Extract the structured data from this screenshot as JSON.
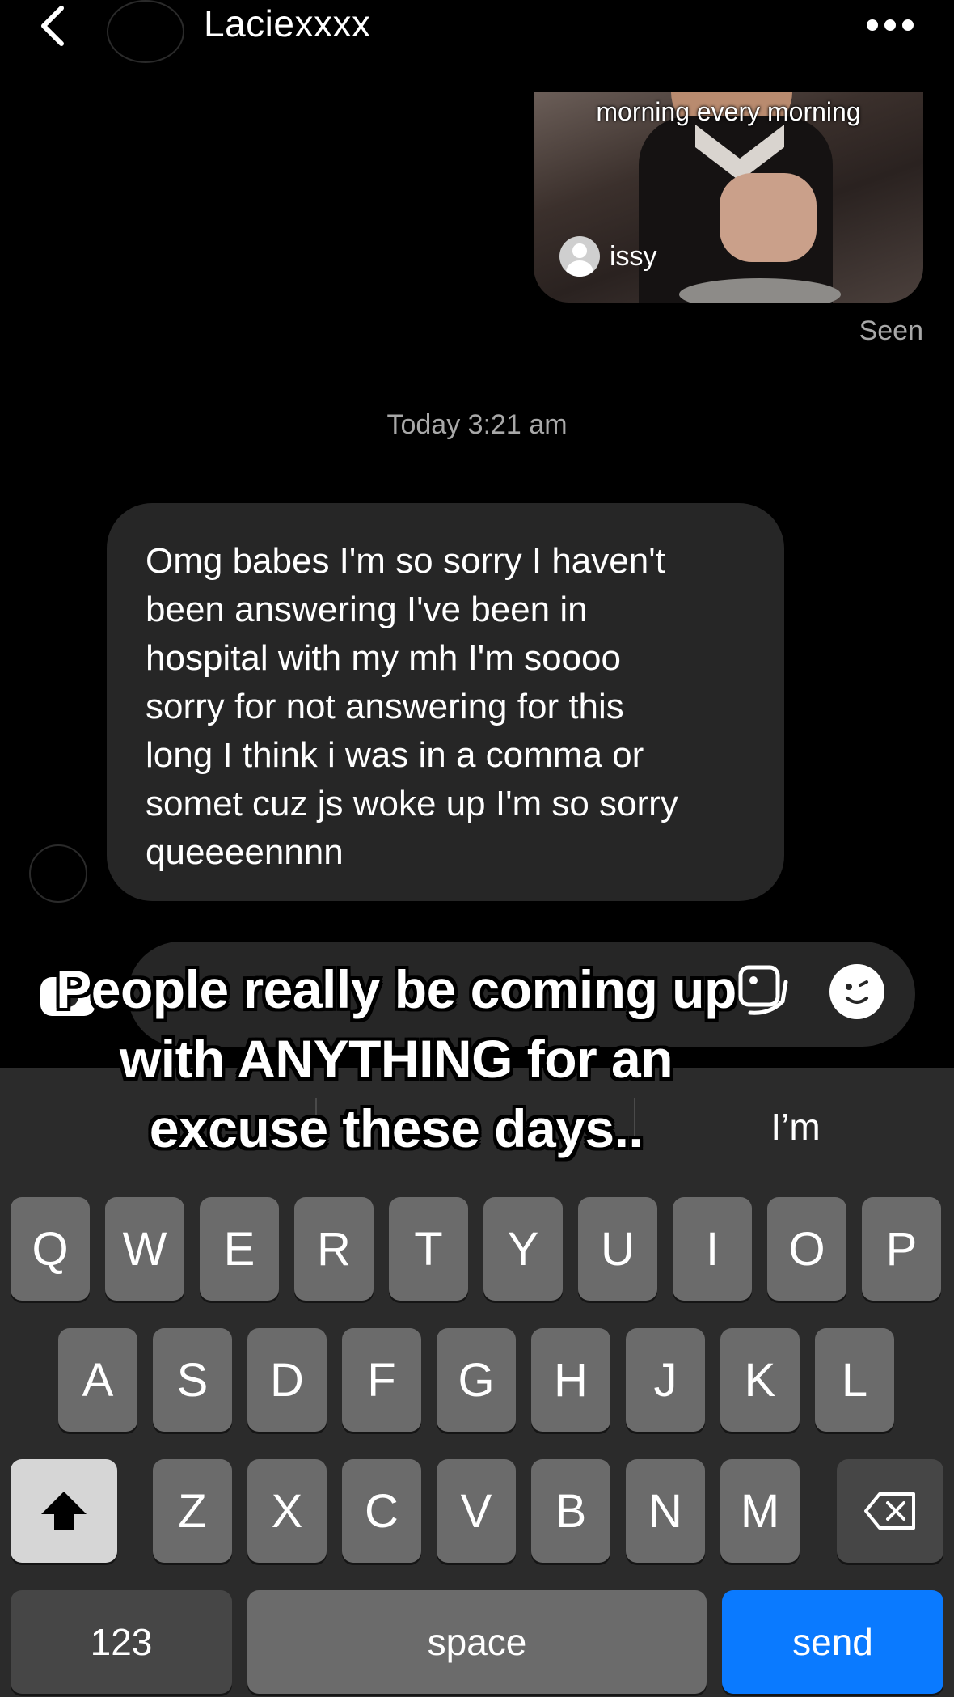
{
  "header": {
    "contact_name": "Laciexxxx"
  },
  "shared_post": {
    "caption": "morning every morning",
    "author": "issy"
  },
  "status": {
    "seen": "Seen",
    "timestamp": "Today 3:21 am"
  },
  "incoming_message": {
    "text": "Omg babes I'm so sorry I haven't\nbeen answering I've been in\nhospital with my mh I'm soooo\nsorry for not answering for this\nlong I think i was in a comma or\nsomet cuz js woke up I'm so sorry\nqueeeennnn"
  },
  "overlay": {
    "caption": "People really be coming up with ANYTHING for an excuse these days.."
  },
  "keyboard": {
    "suggestions": [
      "",
      "",
      "I’m"
    ],
    "row1": [
      "Q",
      "W",
      "E",
      "R",
      "T",
      "Y",
      "U",
      "I",
      "O",
      "P"
    ],
    "row2": [
      "A",
      "S",
      "D",
      "F",
      "G",
      "H",
      "J",
      "K",
      "L"
    ],
    "row3": [
      "Z",
      "X",
      "C",
      "V",
      "B",
      "N",
      "M"
    ],
    "numbers_label": "123",
    "space_label": "space",
    "send_label": "send"
  },
  "colors": {
    "background": "#000000",
    "bubble": "#262626",
    "keyboard": "#2b2b2b",
    "key": "#6b6b6b",
    "send": "#0a7aff"
  },
  "icons": [
    "back-icon",
    "more-icon",
    "camera-icon",
    "gallery-icon",
    "sticker-icon",
    "shift-icon",
    "backspace-icon"
  ]
}
